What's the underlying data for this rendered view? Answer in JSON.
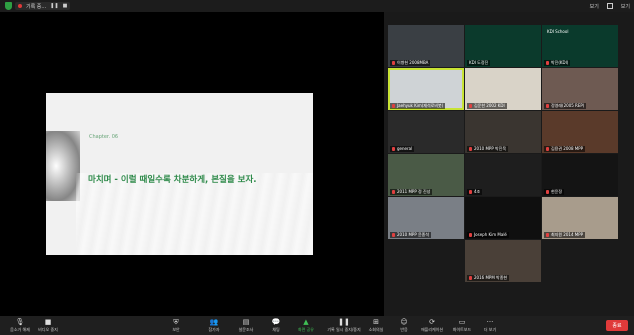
{
  "topbar": {
    "recording_label": "기록 중...",
    "pause_icon": "pause-icon",
    "stop_icon": "stop-icon",
    "security_icon": "shield-icon",
    "view_label": "보기",
    "speaker_label": "보기"
  },
  "slide": {
    "chapter": "Chapter. 06",
    "heading": "마치며 - 이럴 때일수록 차분하게, 본질을 보자."
  },
  "tiles": [
    {
      "name": "이병헌 2008MBA",
      "bg": "#3a3f44",
      "muted": true
    },
    {
      "name": "KDI 도정진",
      "bg": "#0b3a2c",
      "muted": false
    },
    {
      "name": "박진(KDI)",
      "bg": "#0a3a2c",
      "muted": true,
      "brand": "KDI School"
    },
    {
      "name": "Jaehyuk Kim(재석로비봇)",
      "bg": "#cfd3d6",
      "muted": true
    },
    {
      "name": "김운한 2002 KDI",
      "bg": "#d9d3c8",
      "muted": true
    },
    {
      "name": "정영래(2005 REP)",
      "bg": "#6e5a52",
      "muted": true
    },
    {
      "name": "general",
      "bg": "#2a2a2a",
      "muted": true
    },
    {
      "name": "2010 MPP 박진묵",
      "bg": "#3a3530",
      "muted": true
    },
    {
      "name": "김용권 2008 MPP",
      "bg": "#5a3a2a",
      "muted": true
    },
    {
      "name": "2011 MPP 정 진성",
      "bg": "#4a5a46",
      "muted": true
    },
    {
      "name": "4조",
      "bg": "#1e1e1e",
      "muted": true
    },
    {
      "name": "현윤정",
      "bg": "#141414",
      "muted": true
    },
    {
      "name": "2010 MPP 윤종석",
      "bg": "#7a7f86",
      "muted": true
    },
    {
      "name": "Joseph Kim Malé",
      "bg": "#0f0f0f",
      "muted": true
    },
    {
      "name": "최지원 2014 MPP",
      "bg": "#a89c8c",
      "muted": true
    },
    {
      "name": "2016 MPM 박종현",
      "bg": "#4a4038",
      "muted": true
    }
  ],
  "controls": [
    {
      "icon": "mic-muted-icon",
      "label": "음소거 해제"
    },
    {
      "icon": "video-icon",
      "label": "비디오 중지"
    },
    {
      "icon": "security-icon",
      "label": "보안"
    },
    {
      "icon": "participants-icon",
      "label": "참가자",
      "count": "78"
    },
    {
      "icon": "poll-icon",
      "label": "설문조사"
    },
    {
      "icon": "chat-icon",
      "label": "채팅"
    },
    {
      "icon": "share-screen-icon",
      "label": "화면 공유"
    },
    {
      "icon": "record-pause-icon",
      "label": "기록 일시 중지/중지"
    },
    {
      "icon": "breakout-icon",
      "label": "소회의실"
    },
    {
      "icon": "reactions-icon",
      "label": "반응"
    },
    {
      "icon": "apps-icon",
      "label": "애플리케이션"
    },
    {
      "icon": "whiteboard-icon",
      "label": "화이트보드"
    },
    {
      "icon": "more-icon",
      "label": "더 보기"
    }
  ],
  "end_button": "종료"
}
